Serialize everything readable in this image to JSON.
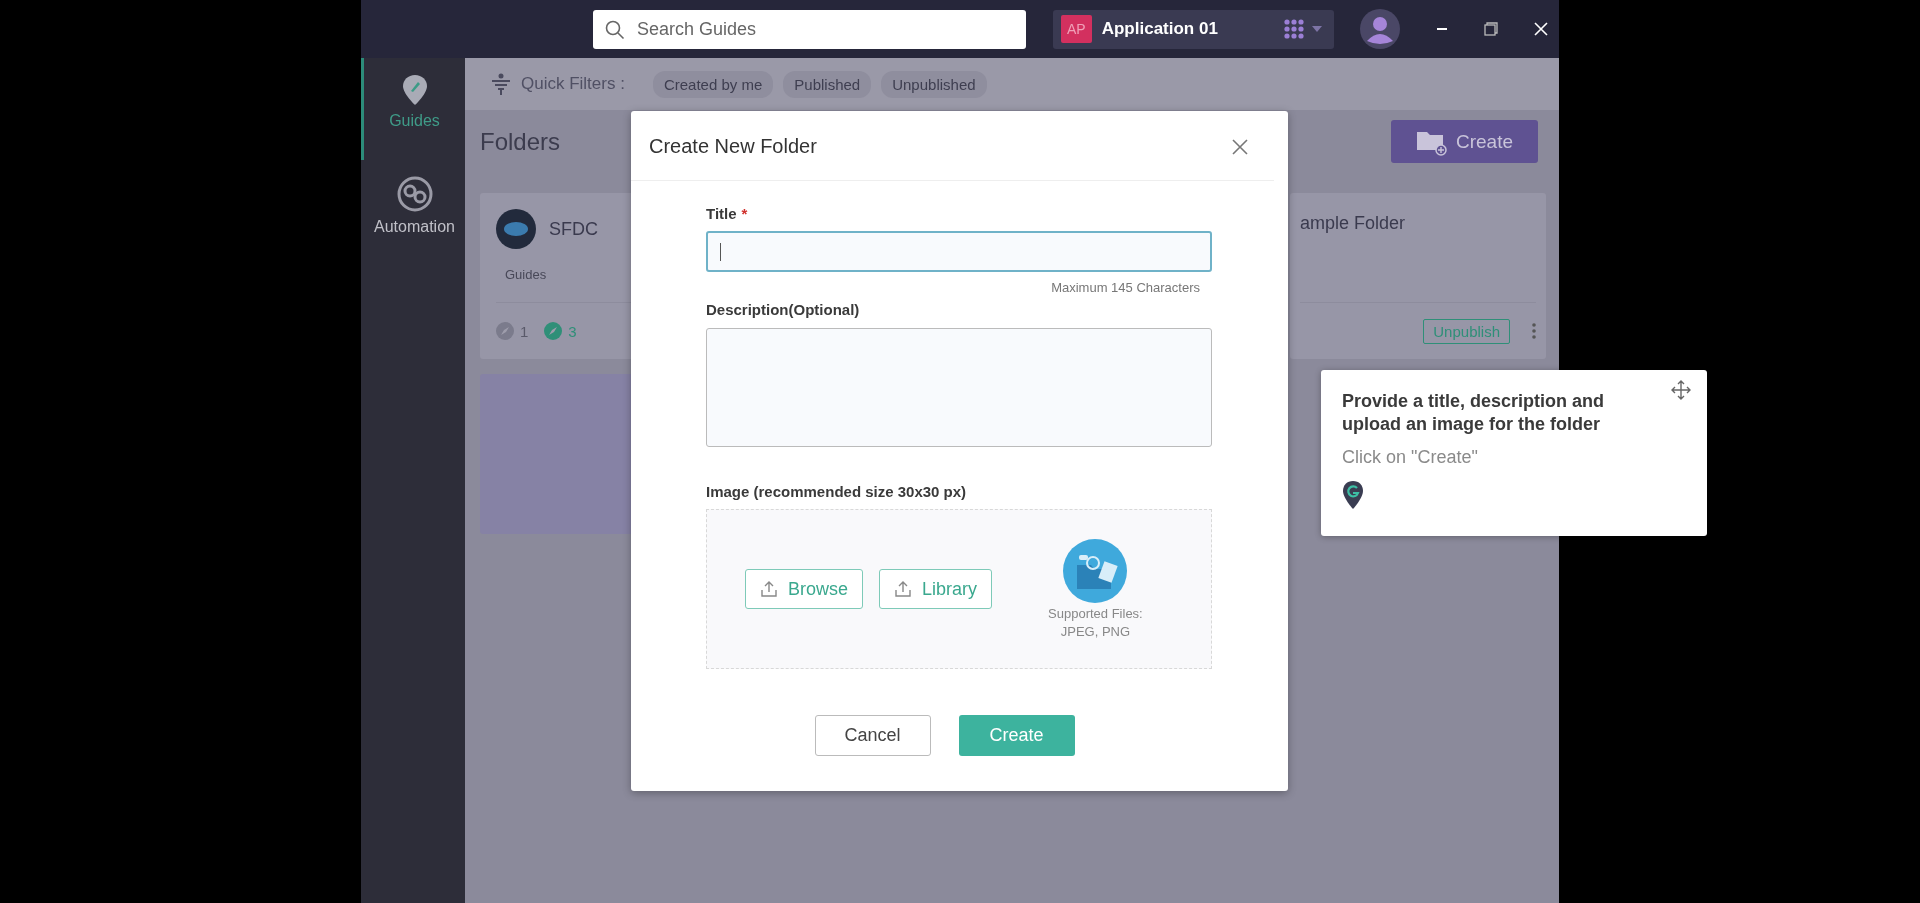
{
  "topbar": {
    "search": {
      "placeholder": "Search Guides"
    },
    "app": {
      "badge": "AP",
      "name": "Application 01"
    }
  },
  "sidebar": {
    "items": [
      {
        "label": "Guides",
        "selected": true,
        "kind": "guides"
      },
      {
        "label": "Automation",
        "selected": false,
        "kind": "automation"
      }
    ]
  },
  "quick_filters": {
    "label": "Quick Filters :",
    "chips": [
      "Created by me",
      "Published",
      "Unpublished"
    ]
  },
  "folders": {
    "title": "Folders",
    "create_button": "Create",
    "cards": [
      {
        "name": "SFDC",
        "subtitle": "Guides",
        "counts": [
          {
            "kind": "draft",
            "value": "1"
          },
          {
            "kind": "published",
            "value": "3"
          }
        ]
      },
      {
        "name": "ample Folder",
        "action": "Unpublish"
      }
    ]
  },
  "dialog": {
    "title": "Create New Folder",
    "fields": [
      {
        "kind": "input",
        "label": "Title",
        "required_mark": "*",
        "focused": true,
        "hint": "Maximum 145 Characters"
      },
      {
        "kind": "textarea",
        "label": "Description(Optional)",
        "focused": false
      }
    ],
    "image": {
      "label": "Image (recommended size 30x30 px)",
      "buttons": [
        "Browse",
        "Library"
      ],
      "supported": [
        "Supported Files:",
        "JPEG, PNG"
      ]
    },
    "buttons": [
      {
        "kind": "secondary",
        "label": "Cancel"
      },
      {
        "kind": "primary",
        "label": "Create"
      }
    ]
  },
  "tooltip": {
    "heading": "Provide a title, description and upload an image for the folder",
    "instruction": "Click on \"Create\""
  }
}
